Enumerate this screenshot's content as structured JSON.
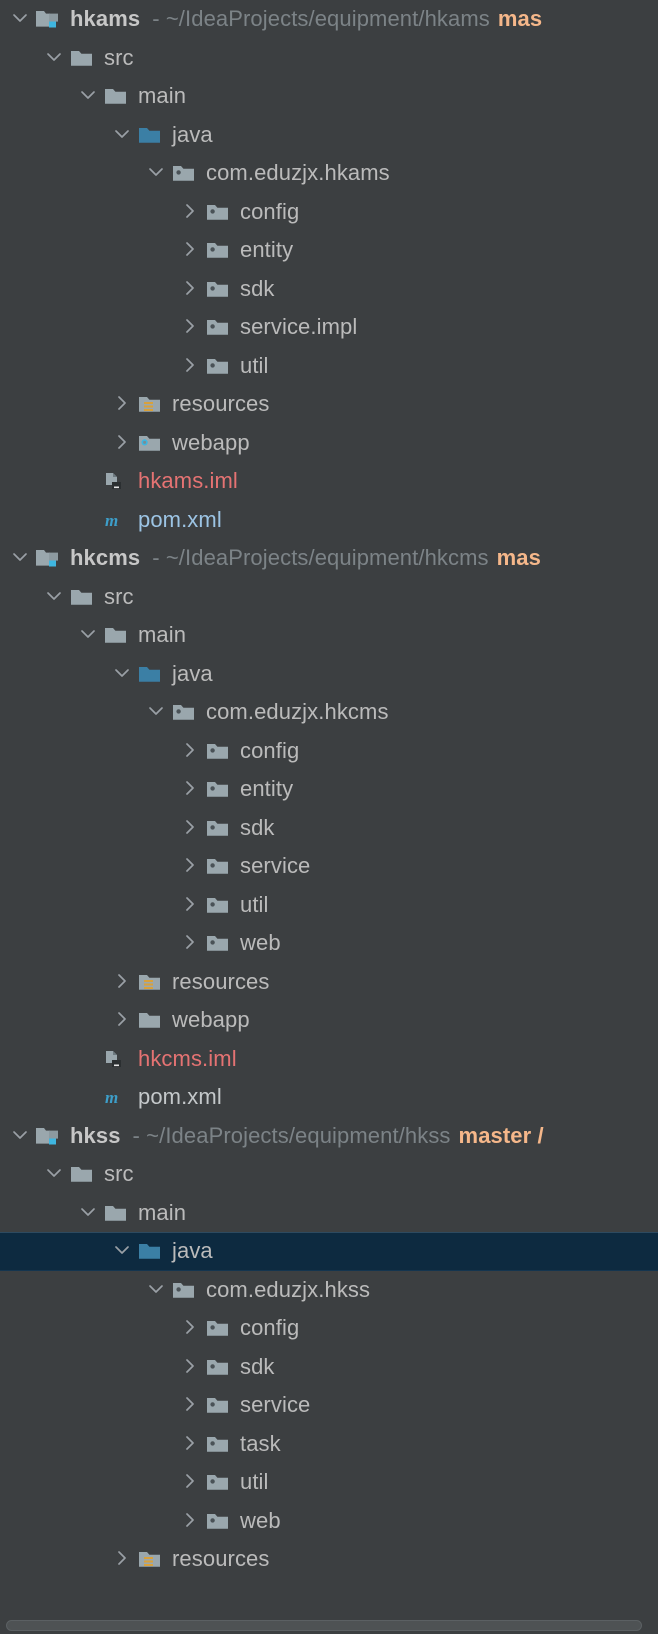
{
  "panel": {
    "name": "project-tool-window",
    "background": "#3c3f41",
    "selection_color": "#0d2a40",
    "text_color": "#bbbbbb",
    "branch_color": "#f5b78a",
    "iml_color": "#e57373",
    "path_color": "#7c8387"
  },
  "rows": [
    {
      "indent": 0,
      "arrow": "expanded",
      "icon": "module-icon",
      "label": "hkams",
      "style": "bold",
      "path": "- ~/IdeaProjects/equipment/hkams",
      "branch": "mas",
      "selected": false
    },
    {
      "indent": 1,
      "arrow": "expanded",
      "icon": "folder-icon",
      "label": "src",
      "style": "",
      "selected": false
    },
    {
      "indent": 2,
      "arrow": "expanded",
      "icon": "folder-icon",
      "label": "main",
      "style": "",
      "selected": false
    },
    {
      "indent": 3,
      "arrow": "expanded",
      "icon": "source-root-icon",
      "label": "java",
      "style": "",
      "selected": false
    },
    {
      "indent": 4,
      "arrow": "expanded",
      "icon": "package-icon",
      "label": "com.eduzjx.hkams",
      "style": "",
      "selected": false
    },
    {
      "indent": 5,
      "arrow": "collapsed",
      "icon": "package-icon",
      "label": "config",
      "style": "",
      "selected": false
    },
    {
      "indent": 5,
      "arrow": "collapsed",
      "icon": "package-icon",
      "label": "entity",
      "style": "",
      "selected": false
    },
    {
      "indent": 5,
      "arrow": "collapsed",
      "icon": "package-icon",
      "label": "sdk",
      "style": "",
      "selected": false
    },
    {
      "indent": 5,
      "arrow": "collapsed",
      "icon": "package-icon",
      "label": "service.impl",
      "style": "",
      "selected": false
    },
    {
      "indent": 5,
      "arrow": "collapsed",
      "icon": "package-icon",
      "label": "util",
      "style": "",
      "selected": false
    },
    {
      "indent": 3,
      "arrow": "collapsed",
      "icon": "resources-root-icon",
      "label": "resources",
      "style": "",
      "selected": false
    },
    {
      "indent": 3,
      "arrow": "collapsed",
      "icon": "webapp-folder-icon",
      "label": "webapp",
      "style": "",
      "selected": false
    },
    {
      "indent": 2,
      "arrow": "none",
      "icon": "iml-file-icon",
      "label": "hkams.iml",
      "style": "red",
      "selected": false
    },
    {
      "indent": 2,
      "arrow": "none",
      "icon": "maven-pom-icon",
      "label": "pom.xml",
      "style": "blue",
      "selected": false
    },
    {
      "indent": 0,
      "arrow": "expanded",
      "icon": "module-icon",
      "label": "hkcms",
      "style": "bold",
      "path": "- ~/IdeaProjects/equipment/hkcms",
      "branch": "mas",
      "selected": false
    },
    {
      "indent": 1,
      "arrow": "expanded",
      "icon": "folder-icon",
      "label": "src",
      "style": "",
      "selected": false
    },
    {
      "indent": 2,
      "arrow": "expanded",
      "icon": "folder-icon",
      "label": "main",
      "style": "",
      "selected": false
    },
    {
      "indent": 3,
      "arrow": "expanded",
      "icon": "source-root-icon",
      "label": "java",
      "style": "",
      "selected": false
    },
    {
      "indent": 4,
      "arrow": "expanded",
      "icon": "package-icon",
      "label": "com.eduzjx.hkcms",
      "style": "",
      "selected": false
    },
    {
      "indent": 5,
      "arrow": "collapsed",
      "icon": "package-icon",
      "label": "config",
      "style": "",
      "selected": false
    },
    {
      "indent": 5,
      "arrow": "collapsed",
      "icon": "package-icon",
      "label": "entity",
      "style": "",
      "selected": false
    },
    {
      "indent": 5,
      "arrow": "collapsed",
      "icon": "package-icon",
      "label": "sdk",
      "style": "",
      "selected": false
    },
    {
      "indent": 5,
      "arrow": "collapsed",
      "icon": "package-icon",
      "label": "service",
      "style": "",
      "selected": false
    },
    {
      "indent": 5,
      "arrow": "collapsed",
      "icon": "package-icon",
      "label": "util",
      "style": "",
      "selected": false
    },
    {
      "indent": 5,
      "arrow": "collapsed",
      "icon": "package-icon",
      "label": "web",
      "style": "",
      "selected": false
    },
    {
      "indent": 3,
      "arrow": "collapsed",
      "icon": "resources-root-icon",
      "label": "resources",
      "style": "",
      "selected": false
    },
    {
      "indent": 3,
      "arrow": "collapsed",
      "icon": "folder-icon",
      "label": "webapp",
      "style": "",
      "selected": false
    },
    {
      "indent": 2,
      "arrow": "none",
      "icon": "iml-file-icon",
      "label": "hkcms.iml",
      "style": "red",
      "selected": false
    },
    {
      "indent": 2,
      "arrow": "none",
      "icon": "maven-pom-icon",
      "label": "pom.xml",
      "style": "white",
      "selected": false
    },
    {
      "indent": 0,
      "arrow": "expanded",
      "icon": "module-icon",
      "label": "hkss",
      "style": "bold",
      "path": "- ~/IdeaProjects/equipment/hkss",
      "branch": "master /",
      "selected": false
    },
    {
      "indent": 1,
      "arrow": "expanded",
      "icon": "folder-icon",
      "label": "src",
      "style": "",
      "selected": false
    },
    {
      "indent": 2,
      "arrow": "expanded",
      "icon": "folder-icon",
      "label": "main",
      "style": "",
      "selected": false
    },
    {
      "indent": 3,
      "arrow": "expanded",
      "icon": "source-root-icon",
      "label": "java",
      "style": "",
      "selected": true
    },
    {
      "indent": 4,
      "arrow": "expanded",
      "icon": "package-icon",
      "label": "com.eduzjx.hkss",
      "style": "",
      "selected": false
    },
    {
      "indent": 5,
      "arrow": "collapsed",
      "icon": "package-icon",
      "label": "config",
      "style": "",
      "selected": false
    },
    {
      "indent": 5,
      "arrow": "collapsed",
      "icon": "package-icon",
      "label": "sdk",
      "style": "",
      "selected": false
    },
    {
      "indent": 5,
      "arrow": "collapsed",
      "icon": "package-icon",
      "label": "service",
      "style": "",
      "selected": false
    },
    {
      "indent": 5,
      "arrow": "collapsed",
      "icon": "package-icon",
      "label": "task",
      "style": "",
      "selected": false
    },
    {
      "indent": 5,
      "arrow": "collapsed",
      "icon": "package-icon",
      "label": "util",
      "style": "",
      "selected": false
    },
    {
      "indent": 5,
      "arrow": "collapsed",
      "icon": "package-icon",
      "label": "web",
      "style": "",
      "selected": false
    },
    {
      "indent": 3,
      "arrow": "collapsed",
      "icon": "resources-root-icon",
      "label": "resources",
      "style": "",
      "selected": false
    }
  ]
}
